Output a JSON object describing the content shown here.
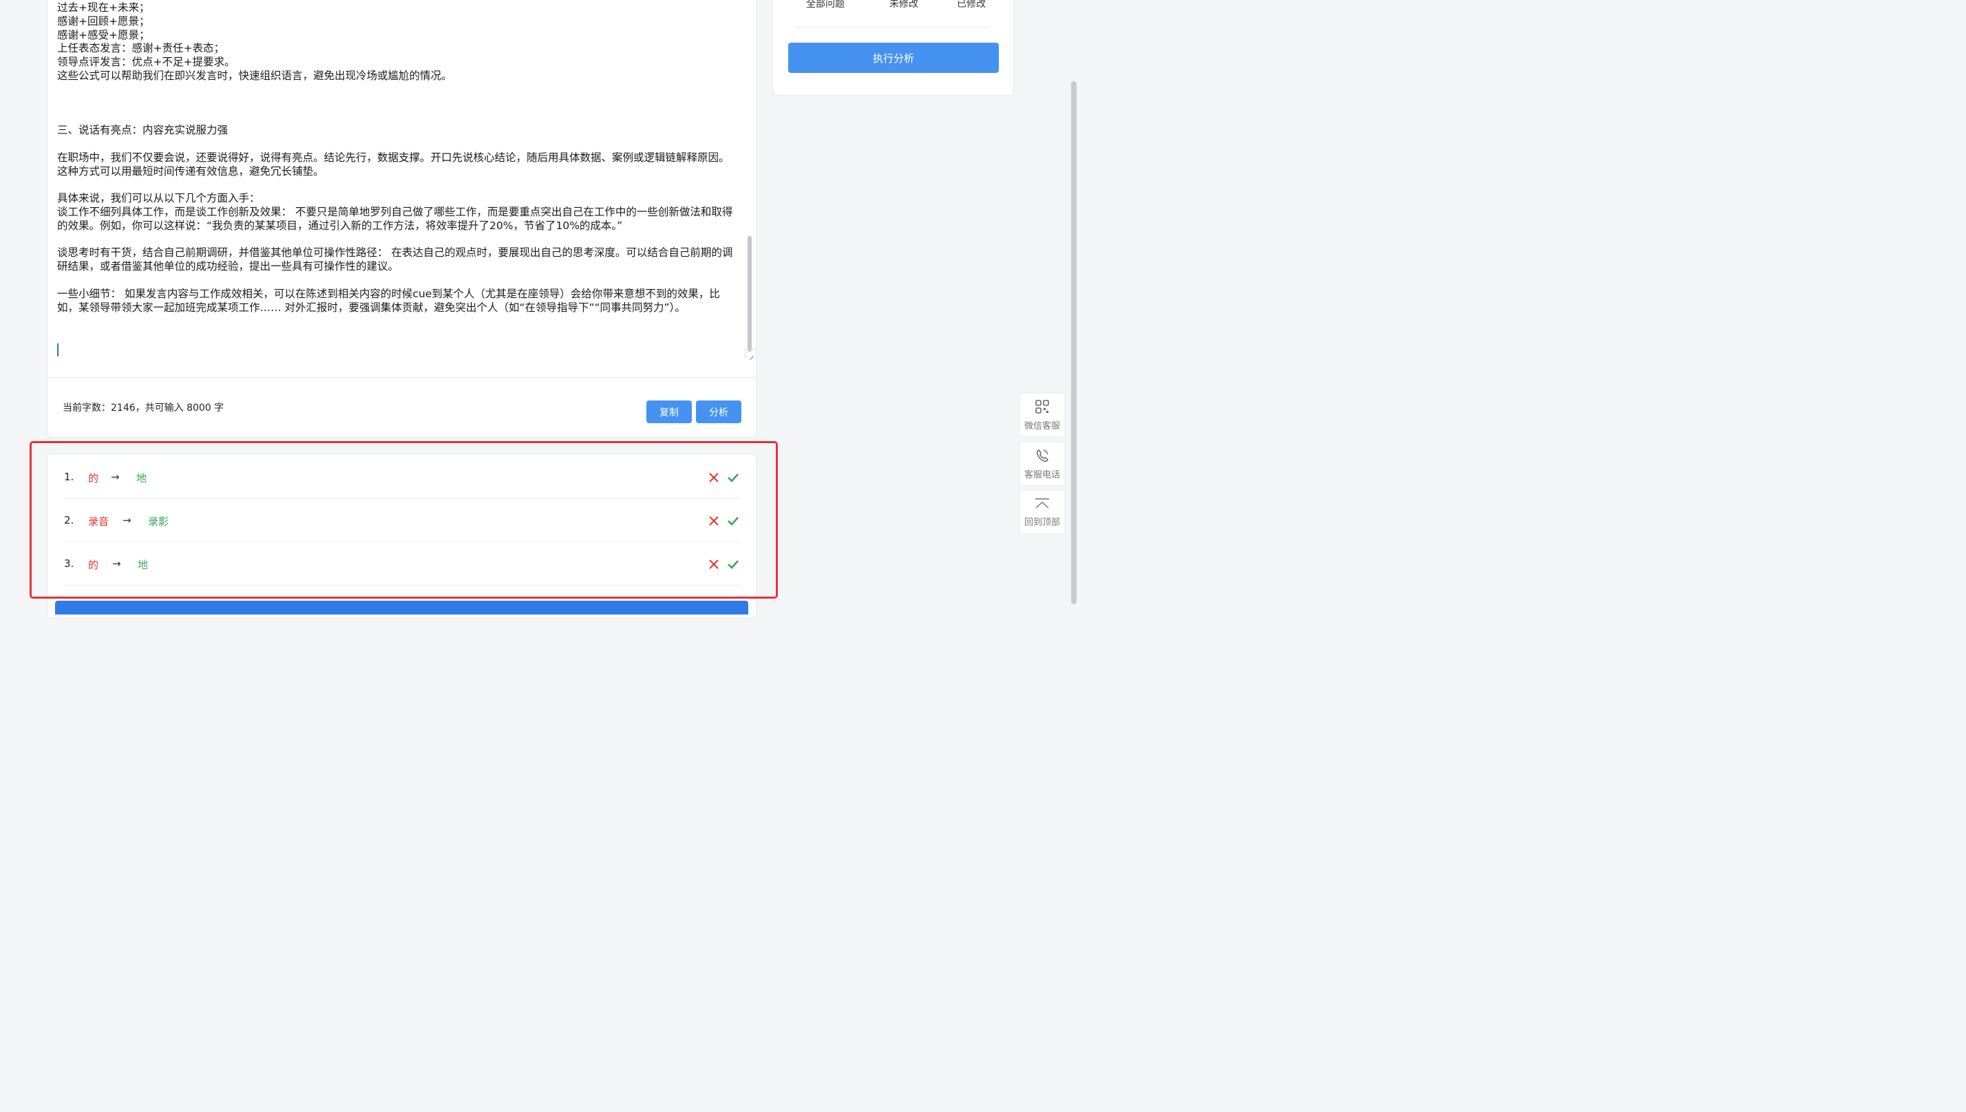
{
  "editor": {
    "text": "过去+现在+未来；\n感谢+回顾+愿景；\n感谢+感受+愿景；\n上任表态发言：感谢+责任+表态；\n领导点评发言：优点+不足+提要求。\n这些公式可以帮助我们在即兴发言时，快速组织语言，避免出现冷场或尴尬的情况。\n\n\n\n三、说话有亮点：内容充实说服力强\n\n在职场中，我们不仅要会说，还要说得好，说得有亮点。结论先行，数据支撑。开口先说核心结论，随后用具体数据、案例或逻辑链解释原因。 这种方式可以用最短时间传递有效信息，避免冗长铺垫。\n\n具体来说，我们可以从以下几个方面入手：\n谈工作不细列具体工作，而是谈工作创新及效果： 不要只是简单地罗列自己做了哪些工作，而是要重点突出自己在工作中的一些创新做法和取得的效果。例如，你可以这样说：“我负责的某某项目，通过引入新的工作方法，将效率提升了20%，节省了10%的成本。”\n\n谈思考时有干货，结合自己前期调研，并借鉴其他单位可操作性路径： 在表达自己的观点时，要展现出自己的思考深度。可以结合自己前期的调研结果，或者借鉴其他单位的成功经验，提出一些具有可操作性的建议。\n\n一些小细节： 如果发言内容与工作成效相关，可以在陈述到相关内容的时候cue到某个人（尤其是在座领导）会给你带来意想不到的效果，比如，某领导带领大家一起加班完成某项工作…… 对外汇报时，要强调集体贡献，避免突出个人（如“在领导指导下”“同事共同努力”）。",
    "word_count": "当前字数：2146，共可输入 8000 字",
    "copy_label": "复制",
    "analyze_label": "分析"
  },
  "right_panel": {
    "tabs": [
      "全部问题",
      "未修改",
      "已修改"
    ],
    "run_label": "执行分析"
  },
  "float_menu": {
    "wechat": "微信客服",
    "phone": "客服电话",
    "top": "回到顶部"
  },
  "corrections": [
    {
      "num": "1.",
      "wrong": "的",
      "right": "地"
    },
    {
      "num": "2.",
      "wrong": "录音",
      "right": "录影"
    },
    {
      "num": "3.",
      "wrong": "的",
      "right": "地"
    }
  ],
  "colors": {
    "accent": "#4592f0",
    "error": "#e0362e",
    "ok": "#3aa356",
    "highlight": "#e8313d"
  }
}
